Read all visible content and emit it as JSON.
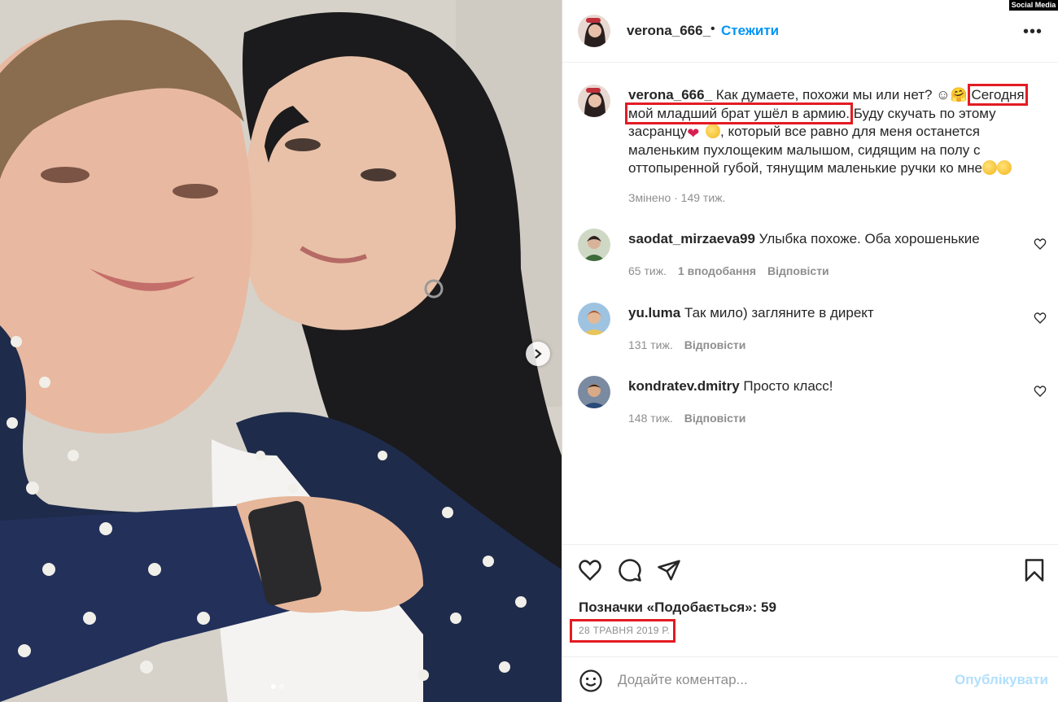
{
  "watermark": "Social Media",
  "post": {
    "author": "verona_666_",
    "separator": "•",
    "follow_label": "Стежити",
    "more_icon": "more-horizontal-icon"
  },
  "caption": {
    "username": "verona_666_",
    "line1": " Как думаете, похожи мы или нет? ☺🤗",
    "highlighted": "Сегодня мой младший брат ушёл в армию.",
    "part2": " Буду скучать по этому засранцу",
    "heart": "❤",
    "part3": ", который все равно для меня останется маленьким пухлощеким малышом, сидящим на полу с оттопыренной губой, тянущим маленькие ручки ко мне",
    "meta": "Змінено · 149 тиж.",
    "highlight_color": "#e31b23"
  },
  "comments": [
    {
      "username": "saodat_mirzaeva99",
      "text": " Улыбка похоже. Оба хорошенькие",
      "time": "65 тиж.",
      "likes": "1 вподобання",
      "reply": "Відповісти"
    },
    {
      "username": "yu.luma",
      "text": " Так мило) загляните в директ",
      "time": "131 тиж.",
      "likes": "",
      "reply": "Відповісти"
    },
    {
      "username": "kondratev.dmitry",
      "text": " Просто класс!",
      "time": "148 тиж.",
      "likes": "",
      "reply": "Відповісти"
    }
  ],
  "actions": {
    "like_icon": "heart-icon",
    "comment_icon": "comment-icon",
    "share_icon": "send-icon",
    "save_icon": "bookmark-icon"
  },
  "likes_text": "Позначки «Подобається»: 59",
  "date_text": "28 ТРАВНЯ 2019 Р.",
  "add_comment": {
    "placeholder": "Додайте коментар...",
    "publish_label": "Опублікувати",
    "emoji_icon": "smiley-icon"
  },
  "colors": {
    "link_blue": "#0095f6",
    "publish_disabled": "#b2dffc",
    "secondary_text": "#8e8e8e",
    "annotation_red": "#e31b23"
  }
}
